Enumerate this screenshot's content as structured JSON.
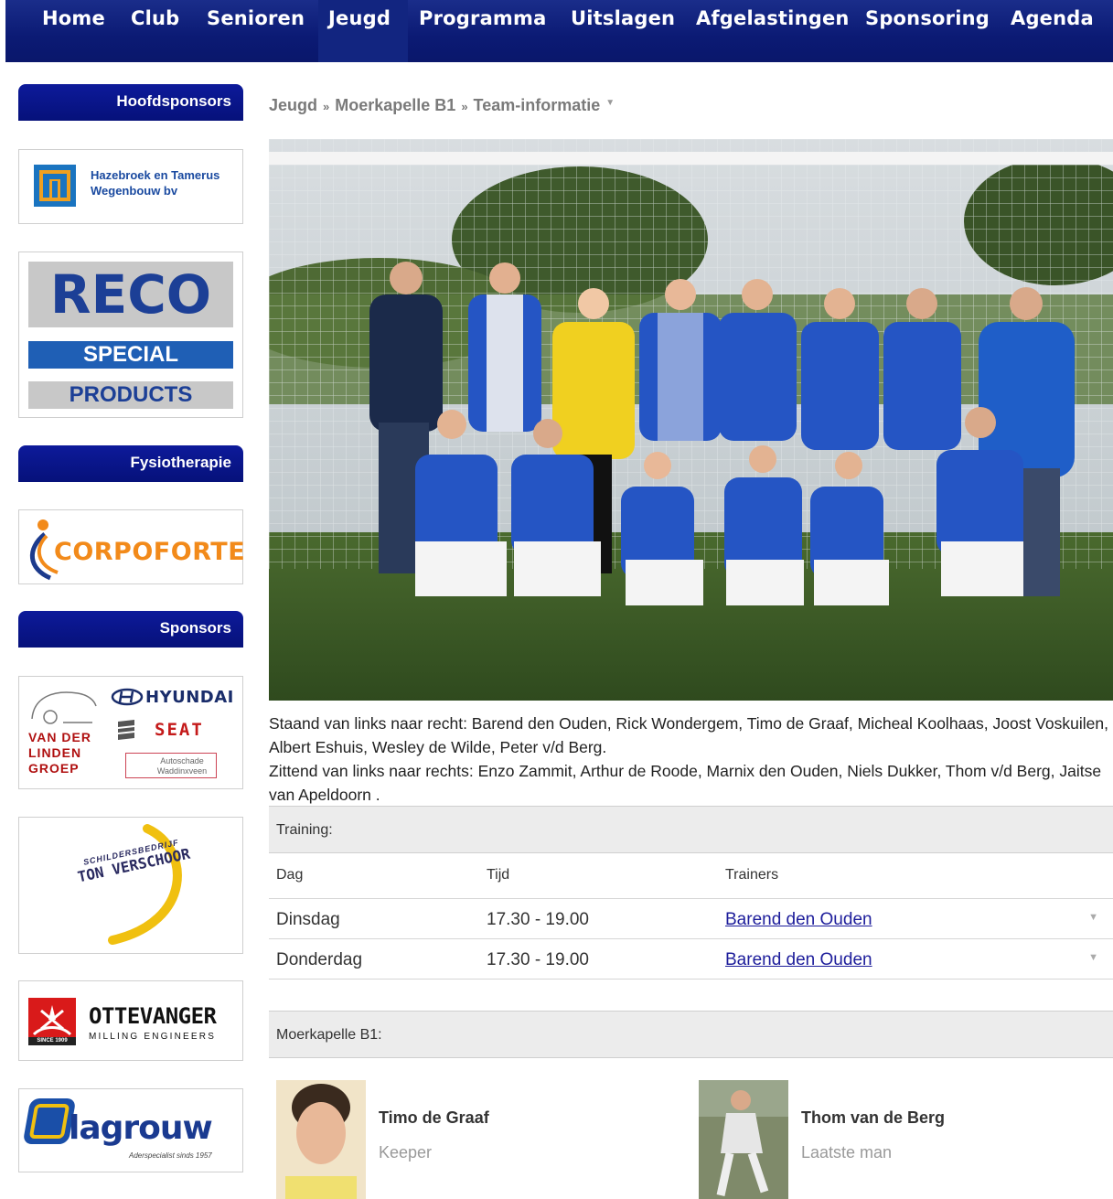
{
  "nav": {
    "items": [
      "Home",
      "Club",
      "Senioren",
      "Jeugd",
      "Programma",
      "Uitslagen",
      "Afgelastingen",
      "Sponsoring",
      "Agenda"
    ],
    "active": "Jeugd"
  },
  "sidebar": {
    "hoofdsponsors_title": "Hoofdsponsors",
    "fysio_title": "Fysiotherapie",
    "sponsors_title": "Sponsors",
    "hazebroek": {
      "line1": "Hazebroek en Tamerus",
      "line2": "Wegenbouw bv"
    },
    "reco": {
      "title": "RECO",
      "special": "SPECIAL",
      "products": "PRODUCTS"
    },
    "corpoforte": "CORPOFORTE",
    "vanderlinden": {
      "l1": "VAN DER",
      "l2": "LINDEN",
      "l3": "GROEP",
      "hyundai": "HYUNDAI",
      "seat": "SEAT",
      "auto1": "Autoschade",
      "auto2": "Waddinxveen"
    },
    "verschoor": {
      "l1": "SCHILDERSBEDRIJF",
      "l2": "TON VERSCHOOR"
    },
    "ottevanger": {
      "l1": "OTTEVANGER",
      "l2": "MILLING ENGINEERS",
      "since": "SINCE 1909"
    },
    "lagrouw": {
      "name": "lagrouw",
      "tag": "Aderspecialist sinds 1957"
    }
  },
  "breadcrumb": [
    "Jeugd",
    "Moerkapelle B1",
    "Team-informatie"
  ],
  "breadcrumb_sep": "»",
  "caption": {
    "line1": "Staand van links naar recht: Barend den Ouden, Rick Wondergem, Timo de Graaf, Micheal Koolhaas, Joost Voskuilen, Albert Eshuis, Wesley de Wilde, Peter v/d Berg.",
    "line2": "Zittend van links naar rechts: Enzo Zammit, Arthur de Roode, Marnix den Ouden, Niels Dukker, Thom v/d Berg, Jaitse van Apeldoorn ."
  },
  "training": {
    "title": "Training:",
    "headers": {
      "dag": "Dag",
      "tijd": "Tijd",
      "trainers": "Trainers"
    },
    "rows": [
      {
        "dag": "Dinsdag",
        "tijd": "17.30 - 19.00",
        "trainer": "Barend den Ouden"
      },
      {
        "dag": "Donderdag",
        "tijd": "17.30 - 19.00",
        "trainer": "Barend den Ouden"
      }
    ]
  },
  "team": {
    "title": "Moerkapelle B1:",
    "players": [
      {
        "name": "Timo de Graaf",
        "role": "Keeper"
      },
      {
        "name": "Thom van de Berg",
        "role": "Laatste man"
      }
    ]
  },
  "colors": {
    "nav": "#0b1a74",
    "sidebar_head": "#0d1a9a",
    "link": "#1d1d9b"
  }
}
